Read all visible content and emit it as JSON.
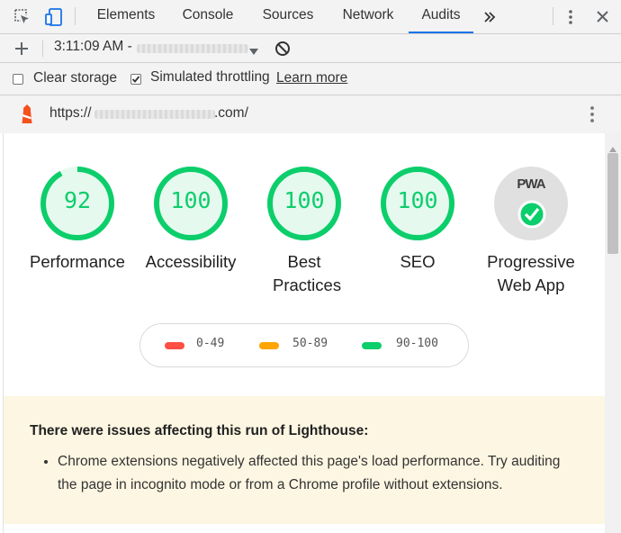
{
  "devtools": {
    "tabs": [
      {
        "label": "Elements",
        "active": false
      },
      {
        "label": "Console",
        "active": false
      },
      {
        "label": "Sources",
        "active": false
      },
      {
        "label": "Network",
        "active": false
      },
      {
        "label": "Audits",
        "active": true
      }
    ],
    "more_tabs_icon": "double-chevron-right-icon"
  },
  "toolbar": {
    "run_time": "3:11:09 AM -",
    "clear_storage_label": "Clear storage",
    "clear_storage_checked": false,
    "throttling_label": "Simulated throttling",
    "throttling_checked": true,
    "learn_more_label": "Learn more"
  },
  "url": {
    "prefix": "https://",
    "suffix": ".com/"
  },
  "scores": [
    {
      "label": "Performance",
      "score": "92",
      "value": 92
    },
    {
      "label": "Accessibility",
      "score": "100",
      "value": 100
    },
    {
      "label": "Best Practices",
      "score": "100",
      "value": 100
    },
    {
      "label": "SEO",
      "score": "100",
      "value": 100
    }
  ],
  "pwa": {
    "badge_text": "PWA",
    "label": "Progressive Web App"
  },
  "legend": [
    {
      "range": "0-49",
      "color": "#ff4e42"
    },
    {
      "range": "50-89",
      "color": "#ffa400"
    },
    {
      "range": "90-100",
      "color": "#0cce6b"
    }
  ],
  "warning": {
    "title": "There were issues affecting this run of Lighthouse:",
    "items": [
      "Chrome extensions negatively affected this page's load performance. Try auditing the page in incognito mode or from a Chrome profile without extensions."
    ]
  },
  "colors": {
    "pass": "#0cce6b",
    "pass_fill": "#e6f9ef",
    "active_tab": "#1a73e8",
    "warning_bg": "#fcf6e2",
    "lighthouse": "#f4511e"
  }
}
